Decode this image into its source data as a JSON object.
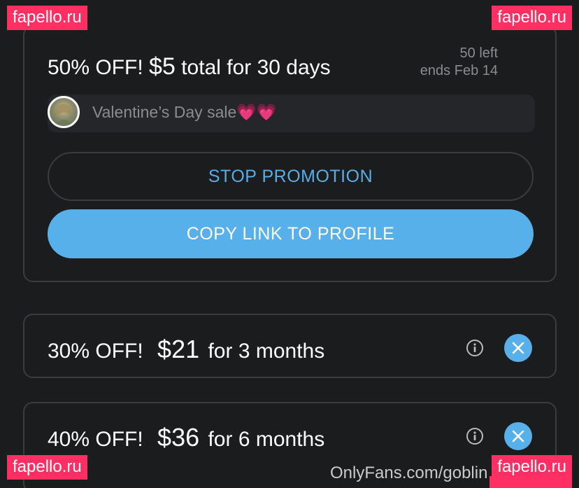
{
  "active_promo": {
    "discount": "50% OFF!",
    "price": "$5",
    "duration": "total for 30 days",
    "remaining": "50 left",
    "ends": "ends Feb 14",
    "message": "Valentine’s Day sale💗💗",
    "stop_label": "STOP PROMOTION",
    "copy_label": "COPY LINK TO PROFILE"
  },
  "bundles": [
    {
      "discount": "30% OFF!",
      "price": "$21",
      "duration": "for 3 months"
    },
    {
      "discount": "40% OFF!",
      "price": "$36",
      "duration": "for 6 months"
    }
  ],
  "footer": {
    "url": "OnlyFans.com/goblin"
  },
  "watermark": "fapello.ru",
  "colors": {
    "accent": "#57b0ea",
    "background": "#1b1c1e",
    "watermark": "#ff2e63"
  },
  "icons": {
    "info": "info-icon",
    "close": "close-icon"
  }
}
